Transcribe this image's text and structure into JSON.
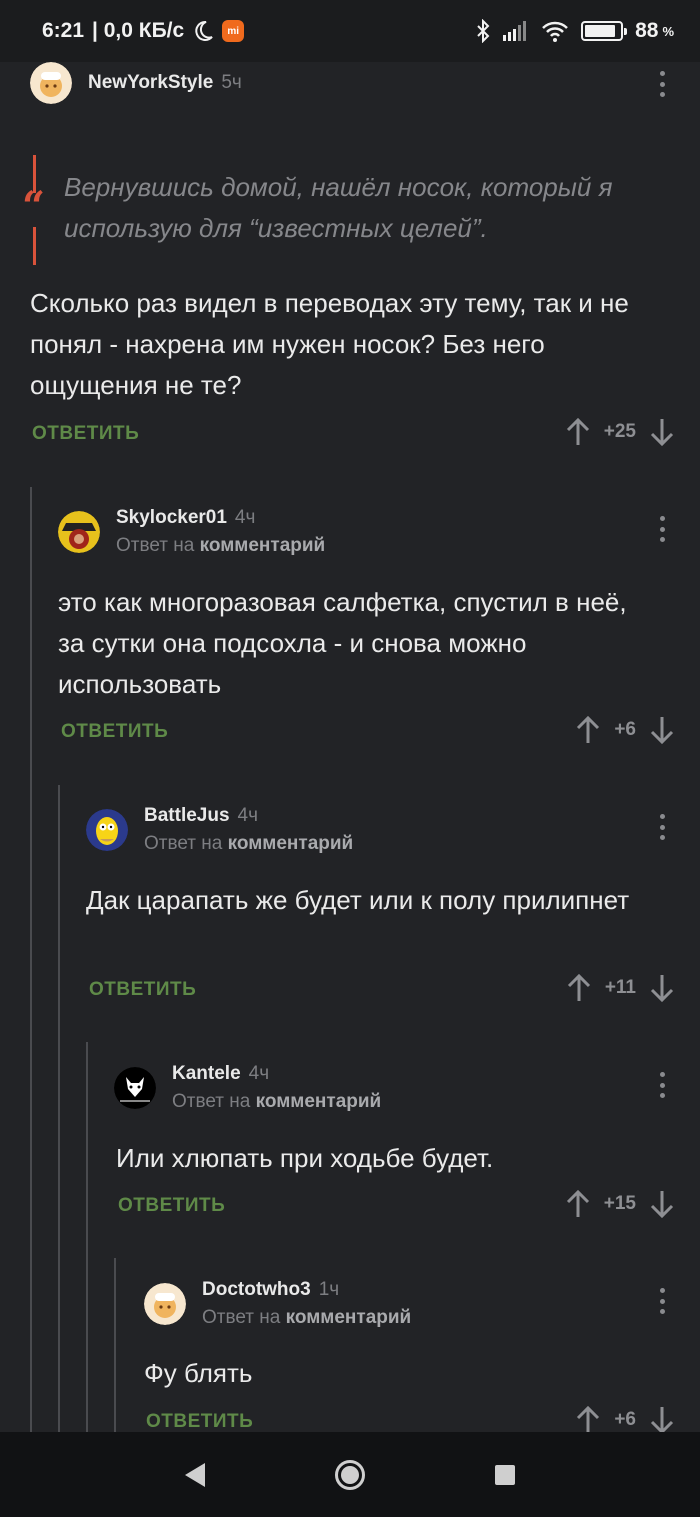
{
  "status_bar": {
    "time": "6:21",
    "net_speed": "| 0,0 КБ/с",
    "battery": "88",
    "battery_percent_sign": "%",
    "battery_level": 0.88,
    "icons": [
      "moon-icon",
      "mi-icon",
      "bluetooth-icon",
      "signal-icon",
      "wifi-icon",
      "battery-icon"
    ]
  },
  "accent_colors": {
    "reply": "#5f8a48",
    "quote": "#d9533b",
    "background": "#222326"
  },
  "comments": [
    {
      "author": "NewYorkStyle",
      "time": "5ч",
      "quote": "Вернувшись домой, нашёл носок, который я использую для “известных целей”.",
      "body": "Сколько раз видел в переводах эту тему, так и не понял - нахрена им нужен носок? Без него ощущения не те?",
      "reply_label": "ОТВЕТИТЬ",
      "score": "+25"
    },
    {
      "author": "Skylocker01",
      "time": "4ч",
      "reply_prefix": "Ответ на",
      "reply_target": "комментарий",
      "body": "это как многоразовая салфетка, спустил в неё, за сутки она подсохла - и снова можно использовать",
      "reply_label": "ОТВЕТИТЬ",
      "score": "+6"
    },
    {
      "author": "BattleJus",
      "time": "4ч",
      "reply_prefix": "Ответ на",
      "reply_target": "комментарий",
      "body": "Дак царапать же будет или к полу прилипнет",
      "reply_label": "ОТВЕТИТЬ",
      "score": "+11"
    },
    {
      "author": "Kantele",
      "time": "4ч",
      "reply_prefix": "Ответ на",
      "reply_target": "комментарий",
      "body": "Или хлюпать при ходьбе будет.",
      "reply_label": "ОТВЕТИТЬ",
      "score": "+15"
    },
    {
      "author": "Doctotwho3",
      "time": "1ч",
      "reply_prefix": "Ответ на",
      "reply_target": "комментарий",
      "body": "Фу блять",
      "reply_label": "ОТВЕТИТЬ",
      "score": "+6"
    }
  ]
}
